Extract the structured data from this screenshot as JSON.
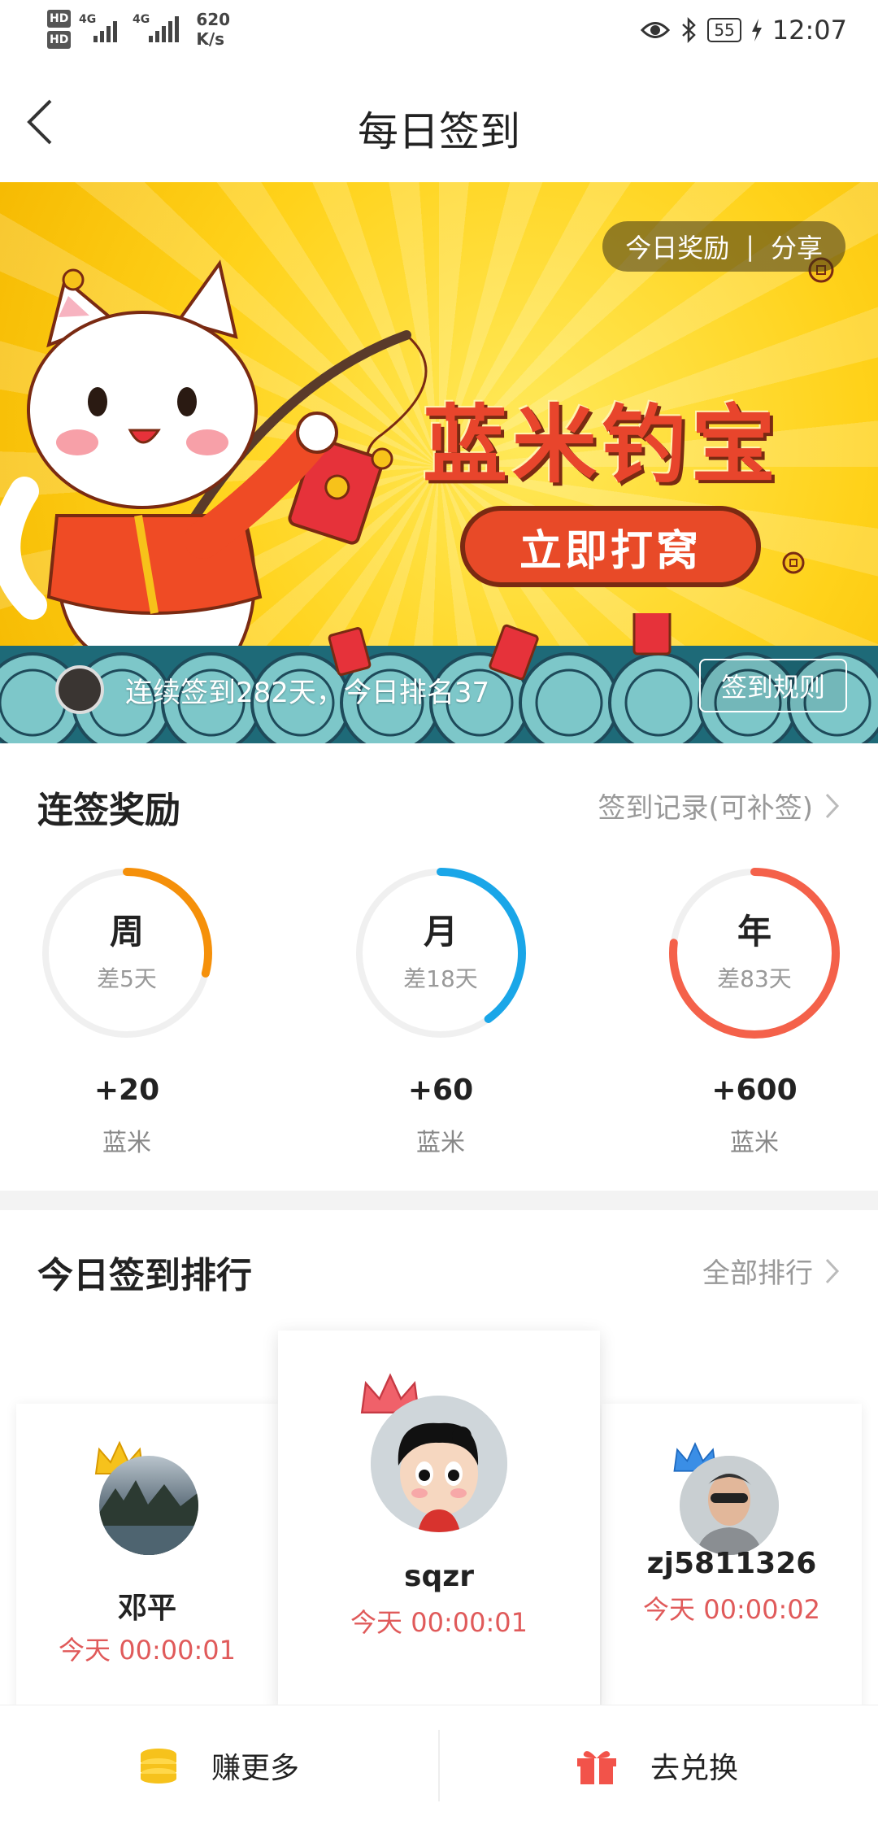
{
  "status_bar": {
    "network_speed": "620",
    "network_unit": "K/s",
    "signal_left_1": "HD",
    "signal_left_2": "HD",
    "net_type_1": "4G",
    "net_type_2": "4G",
    "battery": "55",
    "time": "12:07"
  },
  "nav": {
    "title": "每日签到"
  },
  "banner": {
    "reward_label": "今日奖励",
    "share_label": "分享",
    "separator": "|",
    "title": "蓝米钓宝",
    "cta_label": "立即打窝",
    "streak_text": "连续签到282天，今日排名37",
    "rules_label": "签到规则"
  },
  "rewards": {
    "heading": "连签奖励",
    "record_link": "签到记录(可补签)",
    "items": [
      {
        "period": "周",
        "remaining": "差5天",
        "amount": "+20",
        "unit": "蓝米",
        "progress": 0.29,
        "color": "#f5900a"
      },
      {
        "period": "月",
        "remaining": "差18天",
        "amount": "+60",
        "unit": "蓝米",
        "progress": 0.4,
        "color": "#1aa6e8"
      },
      {
        "period": "年",
        "remaining": "差83天",
        "amount": "+600",
        "unit": "蓝米",
        "progress": 0.77,
        "color": "#f4614a"
      }
    ]
  },
  "ranking": {
    "heading": "今日签到排行",
    "all_link": "全部排行",
    "entries": [
      {
        "rank": 2,
        "name": "邓平",
        "time": "今天 00:00:01",
        "crown_color": "#f6c21c"
      },
      {
        "rank": 1,
        "name": "sqzr",
        "time": "今天 00:00:01",
        "crown_color": "#f0616a"
      },
      {
        "rank": 3,
        "name": "zj5811326",
        "time": "今天 00:00:02",
        "crown_color": "#3a8ee6"
      }
    ]
  },
  "bottom_bar": {
    "earn_label": "赚更多",
    "redeem_label": "去兑换"
  },
  "colors": {
    "accent_orange": "#f5900a",
    "accent_blue": "#1aa6e8",
    "accent_red": "#f4614a",
    "banner_yellow": "#ffd21a",
    "time_red": "#e05a5a"
  }
}
